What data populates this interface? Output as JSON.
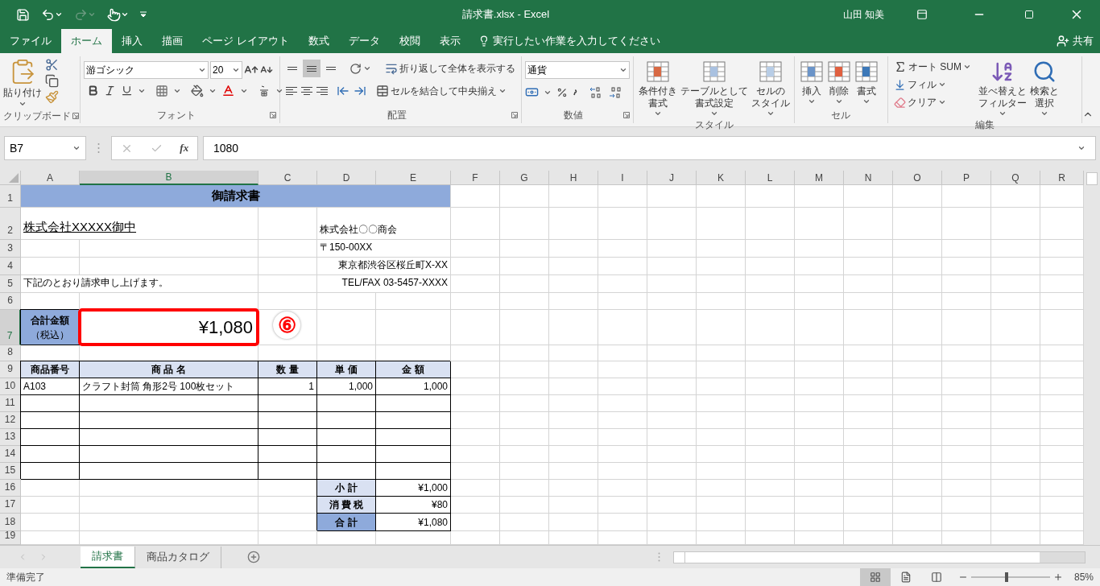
{
  "title_bar": {
    "quick_access": [
      {
        "kind": "save",
        "disabled": false
      },
      {
        "kind": "undo",
        "disabled": false
      },
      {
        "kind": "redo",
        "disabled": true
      },
      {
        "kind": "touch",
        "disabled": false
      }
    ],
    "title": "請求書.xlsx - Excel",
    "user": "山田 知美"
  },
  "menu_tabs": [
    {
      "label": "ファイル",
      "selected": false
    },
    {
      "label": "ホーム",
      "selected": true
    },
    {
      "label": "挿入",
      "selected": false
    },
    {
      "label": "描画",
      "selected": false
    },
    {
      "label": "ページ レイアウト",
      "selected": false
    },
    {
      "label": "数式",
      "selected": false
    },
    {
      "label": "データ",
      "selected": false
    },
    {
      "label": "校閲",
      "selected": false
    },
    {
      "label": "表示",
      "selected": false
    }
  ],
  "tell_me": "実行したい作業を入力してください",
  "share": "共有",
  "ribbon": {
    "clipboard": {
      "label": "クリップボード",
      "paste": "貼り付け"
    },
    "font": {
      "label": "フォント",
      "font_name": "游ゴシック",
      "font_size": "20"
    },
    "alignment": {
      "label": "配置",
      "vertical": [
        {
          "kind": "top",
          "selected": false
        },
        {
          "kind": "middle",
          "selected": true
        },
        {
          "kind": "bottom",
          "selected": false
        }
      ],
      "wrap": "折り返して全体を表示する",
      "merge": "セルを結合して中央揃え"
    },
    "number": {
      "label": "数値",
      "format": "通貨"
    },
    "styles": {
      "label": "スタイル",
      "buttons": [
        [
          "条件付き",
          "書式"
        ],
        [
          "テーブルとして",
          "書式設定"
        ],
        [
          "セルの",
          "スタイル"
        ]
      ]
    },
    "cells": {
      "label": "セル",
      "buttons": [
        [
          "挿入"
        ],
        [
          "削除"
        ],
        [
          "書式"
        ]
      ]
    },
    "editing": {
      "label": "編集",
      "small": [
        "オート SUM",
        "フィル",
        "クリア"
      ],
      "large": [
        [
          "並べ替えと",
          "フィルター"
        ],
        [
          "検索と",
          "選択"
        ]
      ]
    }
  },
  "formula_bar": {
    "name_box": "B7",
    "fx": "fx",
    "formula": "1080"
  },
  "sheet": {
    "columns": [
      {
        "label": "A",
        "selected": false
      },
      {
        "label": "B",
        "selected": true
      },
      {
        "label": "C",
        "selected": false
      },
      {
        "label": "D",
        "selected": false
      },
      {
        "label": "E",
        "selected": false
      },
      {
        "label": "F",
        "selected": false
      },
      {
        "label": "G",
        "selected": false
      },
      {
        "label": "H",
        "selected": false
      },
      {
        "label": "I",
        "selected": false
      },
      {
        "label": "J",
        "selected": false
      },
      {
        "label": "K",
        "selected": false
      },
      {
        "label": "L",
        "selected": false
      },
      {
        "label": "M",
        "selected": false
      },
      {
        "label": "N",
        "selected": false
      },
      {
        "label": "O",
        "selected": false
      },
      {
        "label": "P",
        "selected": false
      },
      {
        "label": "Q",
        "selected": false
      },
      {
        "label": "R",
        "selected": false
      }
    ],
    "rows": [
      {
        "label": "1",
        "selected": false,
        "cells": [
          {
            "kind": "title",
            "text": "御請求書"
          }
        ]
      },
      {
        "label": "2",
        "selected": false,
        "cells": [
          {
            "kind": "company",
            "text": "株式会社XXXXX御中"
          },
          {
            "kind": "plain"
          },
          {
            "kind": "plain",
            "text": "株式会社〇〇商会"
          }
        ]
      },
      {
        "label": "3",
        "selected": false,
        "cells": [
          {
            "kind": "plain"
          },
          {
            "kind": "plain"
          },
          {
            "kind": "plain"
          },
          {
            "kind": "plain",
            "text": "〒150-00XX"
          }
        ]
      },
      {
        "label": "4",
        "selected": false,
        "cells": [
          {
            "kind": "plain"
          },
          {
            "kind": "plain"
          },
          {
            "kind": "plain"
          },
          {
            "kind": "right",
            "text": "東京都渋谷区桜丘町X-XX"
          }
        ]
      },
      {
        "label": "5",
        "selected": false,
        "cells": [
          {
            "kind": "plain",
            "text": "下記のとおり請求申し上げます。"
          },
          {
            "kind": "plain"
          },
          {
            "kind": "right",
            "text": "TEL/FAX 03-5457-XXXX"
          }
        ]
      },
      {
        "label": "6",
        "selected": false,
        "cells": []
      },
      {
        "label": "7",
        "selected": true,
        "cells": [
          {
            "kind": "total_label",
            "text": "合計金額",
            "note": "（税込）"
          },
          {
            "kind": "amount",
            "text": "¥1,080",
            "highlighted": true
          },
          {
            "kind": "plain",
            "callout": "⑥"
          }
        ]
      },
      {
        "label": "8",
        "selected": false,
        "cells": []
      },
      {
        "label": "9",
        "selected": false,
        "cells": [
          {
            "kind": "th",
            "text": "商品番号"
          },
          {
            "kind": "th",
            "text": "商 品 名"
          },
          {
            "kind": "th",
            "text": "数 量"
          },
          {
            "kind": "th",
            "text": "単 価"
          },
          {
            "kind": "th",
            "text": "金 額"
          }
        ]
      },
      {
        "label": "10",
        "selected": false,
        "cells": [
          {
            "kind": "td",
            "text": "A103"
          },
          {
            "kind": "td",
            "text": "クラフト封筒 角形2号 100枚セット"
          },
          {
            "kind": "td_right",
            "text": "1"
          },
          {
            "kind": "td_right",
            "text": "1,000"
          },
          {
            "kind": "td_right",
            "text": "1,000"
          }
        ]
      },
      {
        "label": "11",
        "selected": false,
        "cells": [
          {
            "kind": "td"
          },
          {
            "kind": "td"
          },
          {
            "kind": "td"
          },
          {
            "kind": "td"
          },
          {
            "kind": "td"
          }
        ]
      },
      {
        "label": "12",
        "selected": false,
        "cells": [
          {
            "kind": "td"
          },
          {
            "kind": "td"
          },
          {
            "kind": "td"
          },
          {
            "kind": "td"
          },
          {
            "kind": "td"
          }
        ]
      },
      {
        "label": "13",
        "selected": false,
        "cells": [
          {
            "kind": "td"
          },
          {
            "kind": "td"
          },
          {
            "kind": "td"
          },
          {
            "kind": "td"
          },
          {
            "kind": "td"
          }
        ]
      },
      {
        "label": "14",
        "selected": false,
        "cells": [
          {
            "kind": "td"
          },
          {
            "kind": "td"
          },
          {
            "kind": "td"
          },
          {
            "kind": "td"
          },
          {
            "kind": "td"
          }
        ]
      },
      {
        "label": "15",
        "selected": false,
        "cells": [
          {
            "kind": "td"
          },
          {
            "kind": "td"
          },
          {
            "kind": "td"
          },
          {
            "kind": "td"
          },
          {
            "kind": "td"
          }
        ]
      },
      {
        "label": "16",
        "selected": false,
        "cells": [
          {
            "kind": "plain"
          },
          {
            "kind": "plain"
          },
          {
            "kind": "plain"
          },
          {
            "kind": "sum_label",
            "text": "小 計"
          },
          {
            "kind": "sum_value",
            "text": "¥1,000"
          }
        ]
      },
      {
        "label": "17",
        "selected": false,
        "cells": [
          {
            "kind": "plain"
          },
          {
            "kind": "plain"
          },
          {
            "kind": "plain"
          },
          {
            "kind": "sum_label",
            "text": "消 費 税"
          },
          {
            "kind": "sum_value",
            "text": "¥80"
          }
        ]
      },
      {
        "label": "18",
        "selected": false,
        "cells": [
          {
            "kind": "plain"
          },
          {
            "kind": "plain"
          },
          {
            "kind": "plain"
          },
          {
            "kind": "sum_label_dark",
            "text": "合 計"
          },
          {
            "kind": "sum_value",
            "text": "¥1,080"
          }
        ]
      },
      {
        "label": "19",
        "selected": false,
        "cells": []
      }
    ]
  },
  "sheet_tabs": [
    {
      "label": "請求書",
      "selected": true
    },
    {
      "label": "商品カタログ",
      "selected": false
    }
  ],
  "status_bar": {
    "status": "準備完了",
    "views": [
      {
        "kind": "normal",
        "selected": true
      },
      {
        "kind": "page_layout",
        "selected": false
      },
      {
        "kind": "page_break",
        "selected": false
      }
    ],
    "zoom": {
      "level": 0.45,
      "reading": "85%"
    }
  }
}
